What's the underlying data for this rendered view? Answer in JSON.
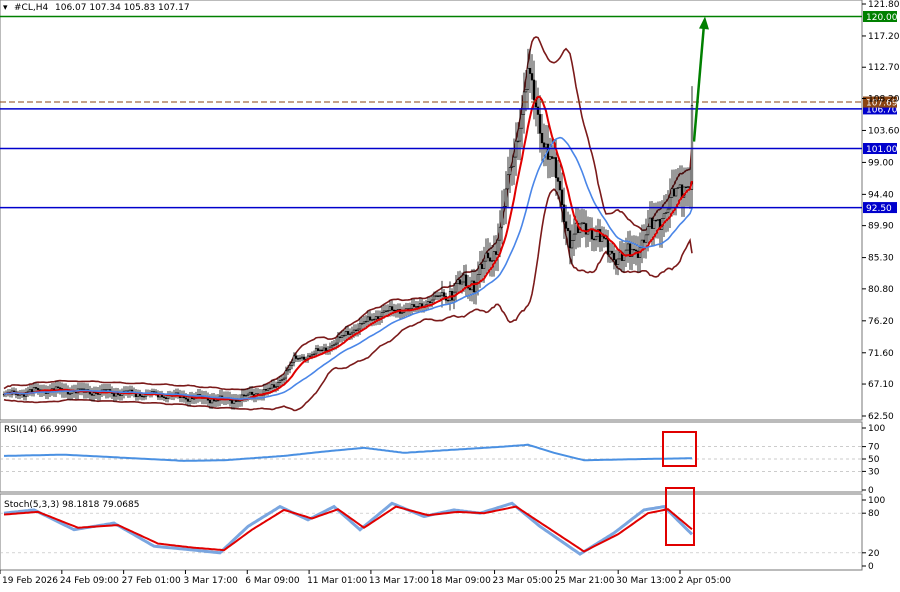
{
  "header": {
    "symbol": "#CL,H4",
    "ohlc": "106.07 107.34 105.83 107.17"
  },
  "chart_data": {
    "type": "candlestick",
    "price_axis": {
      "min": 62.5,
      "max": 121.8,
      "ticks": [
        121.8,
        117.2,
        112.7,
        108.2,
        103.6,
        99.0,
        94.4,
        89.9,
        85.3,
        80.8,
        76.2,
        71.6,
        67.1,
        62.5
      ]
    },
    "levels": [
      {
        "value": 120.0,
        "label": "120.00",
        "color": "#008000"
      },
      {
        "value": 106.7,
        "label": "106.70",
        "color": "#0000cc"
      },
      {
        "value": 101.0,
        "label": "101.00",
        "color": "#0000cc"
      },
      {
        "value": 92.5,
        "label": "92.50",
        "color": "#0000cc"
      }
    ],
    "current_price": {
      "value": 107.69,
      "label": "107.69",
      "color": "#8b4513"
    },
    "arrow": {
      "from": 102,
      "to": 120,
      "color": "#008000"
    },
    "time_labels": [
      "19 Feb 2026",
      "24 Feb 09:00",
      "27 Feb 01:00",
      "3 Mar 17:00",
      "6 Mar 09:00",
      "11 Mar 01:00",
      "13 Mar 17:00",
      "18 Mar 09:00",
      "23 Mar 05:00",
      "25 Mar 21:00",
      "30 Mar 13:00",
      "2 Apr 05:00"
    ],
    "anchors": [
      [
        0,
        65.5
      ],
      [
        20,
        66.3
      ],
      [
        40,
        66.0
      ],
      [
        60,
        65.8
      ],
      [
        80,
        65.5
      ],
      [
        100,
        65.0
      ],
      [
        115,
        64.8
      ],
      [
        135,
        66.5
      ],
      [
        145,
        70.5
      ],
      [
        160,
        72.0
      ],
      [
        175,
        75.0
      ],
      [
        190,
        77.5
      ],
      [
        205,
        78.0
      ],
      [
        220,
        80.0
      ],
      [
        235,
        82.0
      ],
      [
        245,
        86.0
      ],
      [
        255,
        100.0
      ],
      [
        262,
        112.0
      ],
      [
        268,
        104.0
      ],
      [
        275,
        98.0
      ],
      [
        283,
        88.0
      ],
      [
        292,
        90.0
      ],
      [
        300,
        87.0
      ],
      [
        310,
        85.0
      ],
      [
        320,
        88.0
      ],
      [
        330,
        92.0
      ],
      [
        340,
        96.0
      ],
      [
        350,
        97.0
      ],
      [
        360,
        99.0
      ],
      [
        370,
        98.0
      ],
      [
        380,
        100.0
      ],
      [
        390,
        97.0
      ],
      [
        400,
        96.0
      ],
      [
        415,
        97.0
      ],
      [
        430,
        96.0
      ],
      [
        445,
        99.0
      ],
      [
        460,
        98.0
      ],
      [
        475,
        97.0
      ],
      [
        490,
        99.0
      ],
      [
        498,
        100.0
      ],
      [
        503,
        91.0
      ],
      [
        510,
        90.0
      ],
      [
        520,
        93.0
      ],
      [
        530,
        90.0
      ],
      [
        540,
        89.0
      ],
      [
        550,
        91.0
      ],
      [
        560,
        92.0
      ],
      [
        570,
        94.0
      ],
      [
        580,
        96.0
      ],
      [
        590,
        99.0
      ],
      [
        600,
        101.0
      ],
      [
        610,
        103.0
      ],
      [
        620,
        104.0
      ],
      [
        630,
        103.0
      ],
      [
        640,
        103.0
      ],
      [
        650,
        102.0
      ],
      [
        660,
        101.0
      ],
      [
        667,
        99.0
      ],
      [
        672,
        102.0
      ],
      [
        678,
        105.0
      ],
      [
        683,
        107.2
      ]
    ],
    "moving_averages": [
      {
        "name": "fast",
        "color": "#e00000",
        "period": 5
      },
      {
        "name": "slow",
        "color": "#4a86e8",
        "period": 14
      }
    ],
    "bands": {
      "color": "#7b1a1a",
      "period": 22,
      "factor": 1.9
    },
    "rsi": {
      "label": "RSI(14) 66.9990",
      "min": 0,
      "max": 100,
      "ticks": [
        100,
        70,
        50,
        30,
        0
      ],
      "anchors": [
        [
          0,
          55
        ],
        [
          30,
          57
        ],
        [
          60,
          52
        ],
        [
          90,
          47
        ],
        [
          110,
          48
        ],
        [
          140,
          55
        ],
        [
          160,
          62
        ],
        [
          180,
          68
        ],
        [
          200,
          60
        ],
        [
          230,
          66
        ],
        [
          250,
          70
        ],
        [
          262,
          73
        ],
        [
          275,
          60
        ],
        [
          290,
          48
        ],
        [
          320,
          50
        ],
        [
          360,
          52
        ],
        [
          380,
          48
        ],
        [
          420,
          50
        ],
        [
          460,
          52
        ],
        [
          490,
          50
        ],
        [
          500,
          40
        ],
        [
          510,
          43
        ],
        [
          540,
          40
        ],
        [
          570,
          48
        ],
        [
          590,
          50
        ],
        [
          610,
          62
        ],
        [
          630,
          68
        ],
        [
          650,
          55
        ],
        [
          665,
          48
        ],
        [
          675,
          58
        ],
        [
          683,
          67
        ]
      ]
    },
    "stoch": {
      "label": "Stoch(5,3,3) 98.1818 79.0685",
      "min": 0,
      "max": 100,
      "ticks": [
        100,
        80,
        20,
        0
      ],
      "k_anchors": [
        [
          0,
          80
        ],
        [
          15,
          85
        ],
        [
          35,
          55
        ],
        [
          55,
          65
        ],
        [
          75,
          30
        ],
        [
          92,
          25
        ],
        [
          108,
          20
        ],
        [
          122,
          60
        ],
        [
          138,
          90
        ],
        [
          152,
          70
        ],
        [
          165,
          90
        ],
        [
          178,
          55
        ],
        [
          194,
          95
        ],
        [
          210,
          75
        ],
        [
          225,
          85
        ],
        [
          238,
          80
        ],
        [
          254,
          95
        ],
        [
          268,
          60
        ],
        [
          288,
          18
        ],
        [
          305,
          50
        ],
        [
          320,
          85
        ],
        [
          330,
          90
        ],
        [
          345,
          45
        ],
        [
          362,
          95
        ],
        [
          378,
          35
        ],
        [
          392,
          85
        ],
        [
          402,
          55
        ],
        [
          418,
          15
        ],
        [
          436,
          85
        ],
        [
          452,
          40
        ],
        [
          468,
          90
        ],
        [
          485,
          30
        ],
        [
          500,
          90
        ],
        [
          514,
          20
        ],
        [
          530,
          85
        ],
        [
          546,
          25
        ],
        [
          562,
          95
        ],
        [
          577,
          75
        ],
        [
          590,
          95
        ],
        [
          605,
          75
        ],
        [
          620,
          55
        ],
        [
          632,
          80
        ],
        [
          648,
          35
        ],
        [
          664,
          25
        ],
        [
          675,
          55
        ],
        [
          683,
          98
        ]
      ],
      "d_anchors": [
        [
          0,
          78
        ],
        [
          17,
          82
        ],
        [
          37,
          58
        ],
        [
          57,
          62
        ],
        [
          77,
          34
        ],
        [
          94,
          28
        ],
        [
          110,
          24
        ],
        [
          124,
          55
        ],
        [
          140,
          85
        ],
        [
          154,
          72
        ],
        [
          167,
          86
        ],
        [
          180,
          58
        ],
        [
          196,
          90
        ],
        [
          212,
          77
        ],
        [
          227,
          82
        ],
        [
          240,
          80
        ],
        [
          256,
          90
        ],
        [
          270,
          62
        ],
        [
          290,
          22
        ],
        [
          307,
          48
        ],
        [
          322,
          80
        ],
        [
          332,
          86
        ],
        [
          347,
          48
        ],
        [
          364,
          88
        ],
        [
          380,
          40
        ],
        [
          394,
          80
        ],
        [
          404,
          58
        ],
        [
          420,
          20
        ],
        [
          438,
          80
        ],
        [
          454,
          45
        ],
        [
          470,
          85
        ],
        [
          487,
          35
        ],
        [
          502,
          85
        ],
        [
          516,
          25
        ],
        [
          532,
          80
        ],
        [
          548,
          30
        ],
        [
          564,
          88
        ],
        [
          579,
          77
        ],
        [
          592,
          90
        ],
        [
          607,
          77
        ],
        [
          622,
          60
        ],
        [
          634,
          76
        ],
        [
          650,
          40
        ],
        [
          666,
          28
        ],
        [
          677,
          45
        ],
        [
          683,
          79
        ]
      ]
    }
  }
}
